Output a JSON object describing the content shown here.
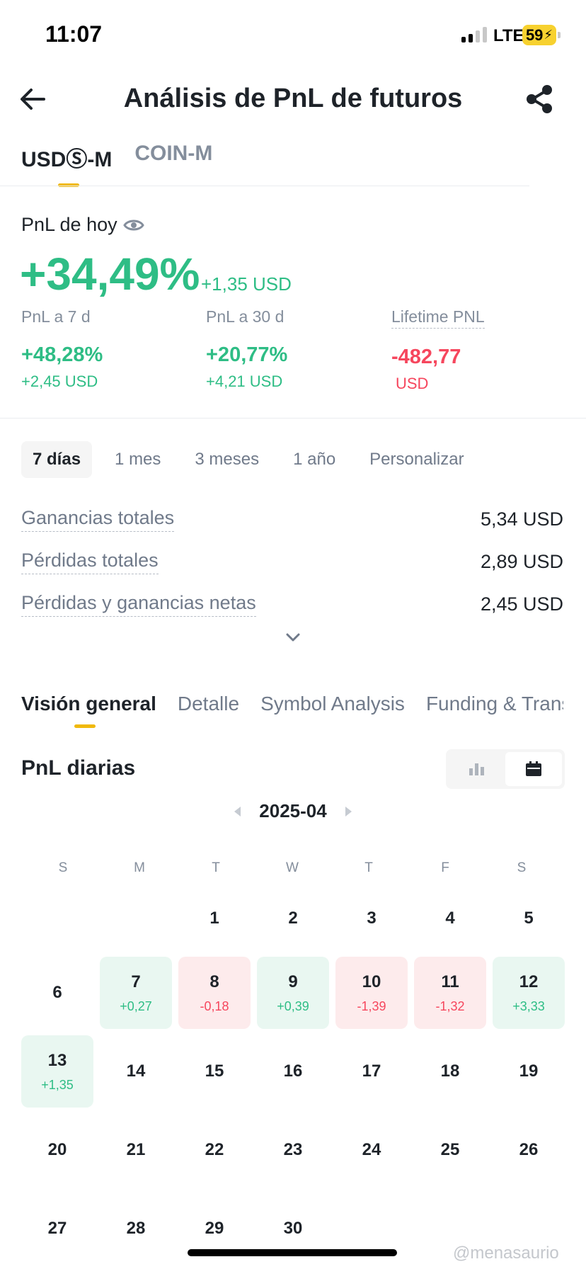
{
  "status": {
    "time": "11:07",
    "network": "LTE",
    "battery": "59"
  },
  "header": {
    "title": "Análisis de PnL de futuros"
  },
  "top_tabs": [
    {
      "label": "USDⓈ-M",
      "active": true
    },
    {
      "label": "COIN-M",
      "active": false
    }
  ],
  "today": {
    "label": "PnL de hoy",
    "percent": "+34,49%",
    "usd": "+1,35 USD"
  },
  "stats": [
    {
      "label": "PnL a 7 d",
      "value": "+48,28%",
      "sub": "+2,45 USD",
      "tone": "green"
    },
    {
      "label": "PnL a 30 d",
      "value": "+20,77%",
      "sub": "+4,21 USD",
      "tone": "green"
    },
    {
      "label": "Lifetime PNL",
      "value": "-482,77",
      "sub": "USD",
      "tone": "red"
    }
  ],
  "periods": [
    {
      "label": "7 días",
      "active": true
    },
    {
      "label": "1 mes",
      "active": false
    },
    {
      "label": "3 meses",
      "active": false
    },
    {
      "label": "1 año",
      "active": false
    },
    {
      "label": "Personalizar",
      "active": false
    }
  ],
  "summary": [
    {
      "label": "Ganancias totales",
      "value": "5,34 USD"
    },
    {
      "label": "Pérdidas totales",
      "value": "2,89 USD"
    },
    {
      "label": "Pérdidas y ganancias netas",
      "value": "2,45 USD"
    }
  ],
  "section_tabs": [
    {
      "label": "Visión general",
      "active": true
    },
    {
      "label": "Detalle",
      "active": false
    },
    {
      "label": "Symbol Analysis",
      "active": false
    },
    {
      "label": "Funding & Transactions",
      "active": false
    }
  ],
  "daily": {
    "title": "PnL diarias",
    "month": "2025-04"
  },
  "weekdays": [
    "S",
    "M",
    "T",
    "W",
    "T",
    "F",
    "S"
  ],
  "calendar": [
    {
      "day": "1",
      "pnl": null
    },
    {
      "day": "2",
      "pnl": null
    },
    {
      "day": "3",
      "pnl": null
    },
    {
      "day": "4",
      "pnl": null
    },
    {
      "day": "5",
      "pnl": null
    },
    {
      "day": "6",
      "pnl": null
    },
    {
      "day": "7",
      "pnl": "+0,27"
    },
    {
      "day": "8",
      "pnl": "-0,18"
    },
    {
      "day": "9",
      "pnl": "+0,39"
    },
    {
      "day": "10",
      "pnl": "-1,39"
    },
    {
      "day": "11",
      "pnl": "-1,32"
    },
    {
      "day": "12",
      "pnl": "+3,33"
    },
    {
      "day": "13",
      "pnl": "+1,35"
    },
    {
      "day": "14",
      "pnl": null
    },
    {
      "day": "15",
      "pnl": null
    },
    {
      "day": "16",
      "pnl": null
    },
    {
      "day": "17",
      "pnl": null
    },
    {
      "day": "18",
      "pnl": null
    },
    {
      "day": "19",
      "pnl": null
    },
    {
      "day": "20",
      "pnl": null
    },
    {
      "day": "21",
      "pnl": null
    },
    {
      "day": "22",
      "pnl": null
    },
    {
      "day": "23",
      "pnl": null
    },
    {
      "day": "24",
      "pnl": null
    },
    {
      "day": "25",
      "pnl": null
    },
    {
      "day": "26",
      "pnl": null
    },
    {
      "day": "27",
      "pnl": null
    },
    {
      "day": "28",
      "pnl": null
    },
    {
      "day": "29",
      "pnl": null
    },
    {
      "day": "30",
      "pnl": null
    }
  ],
  "watermark": "@menasaurio",
  "colors": {
    "gain": "#2ebd85",
    "loss": "#f6465d",
    "accent": "#f0b90b"
  },
  "icons": [
    "back-arrow-icon",
    "share-icon",
    "eye-icon",
    "chevron-down-icon",
    "bar-chart-icon",
    "calendar-icon"
  ]
}
